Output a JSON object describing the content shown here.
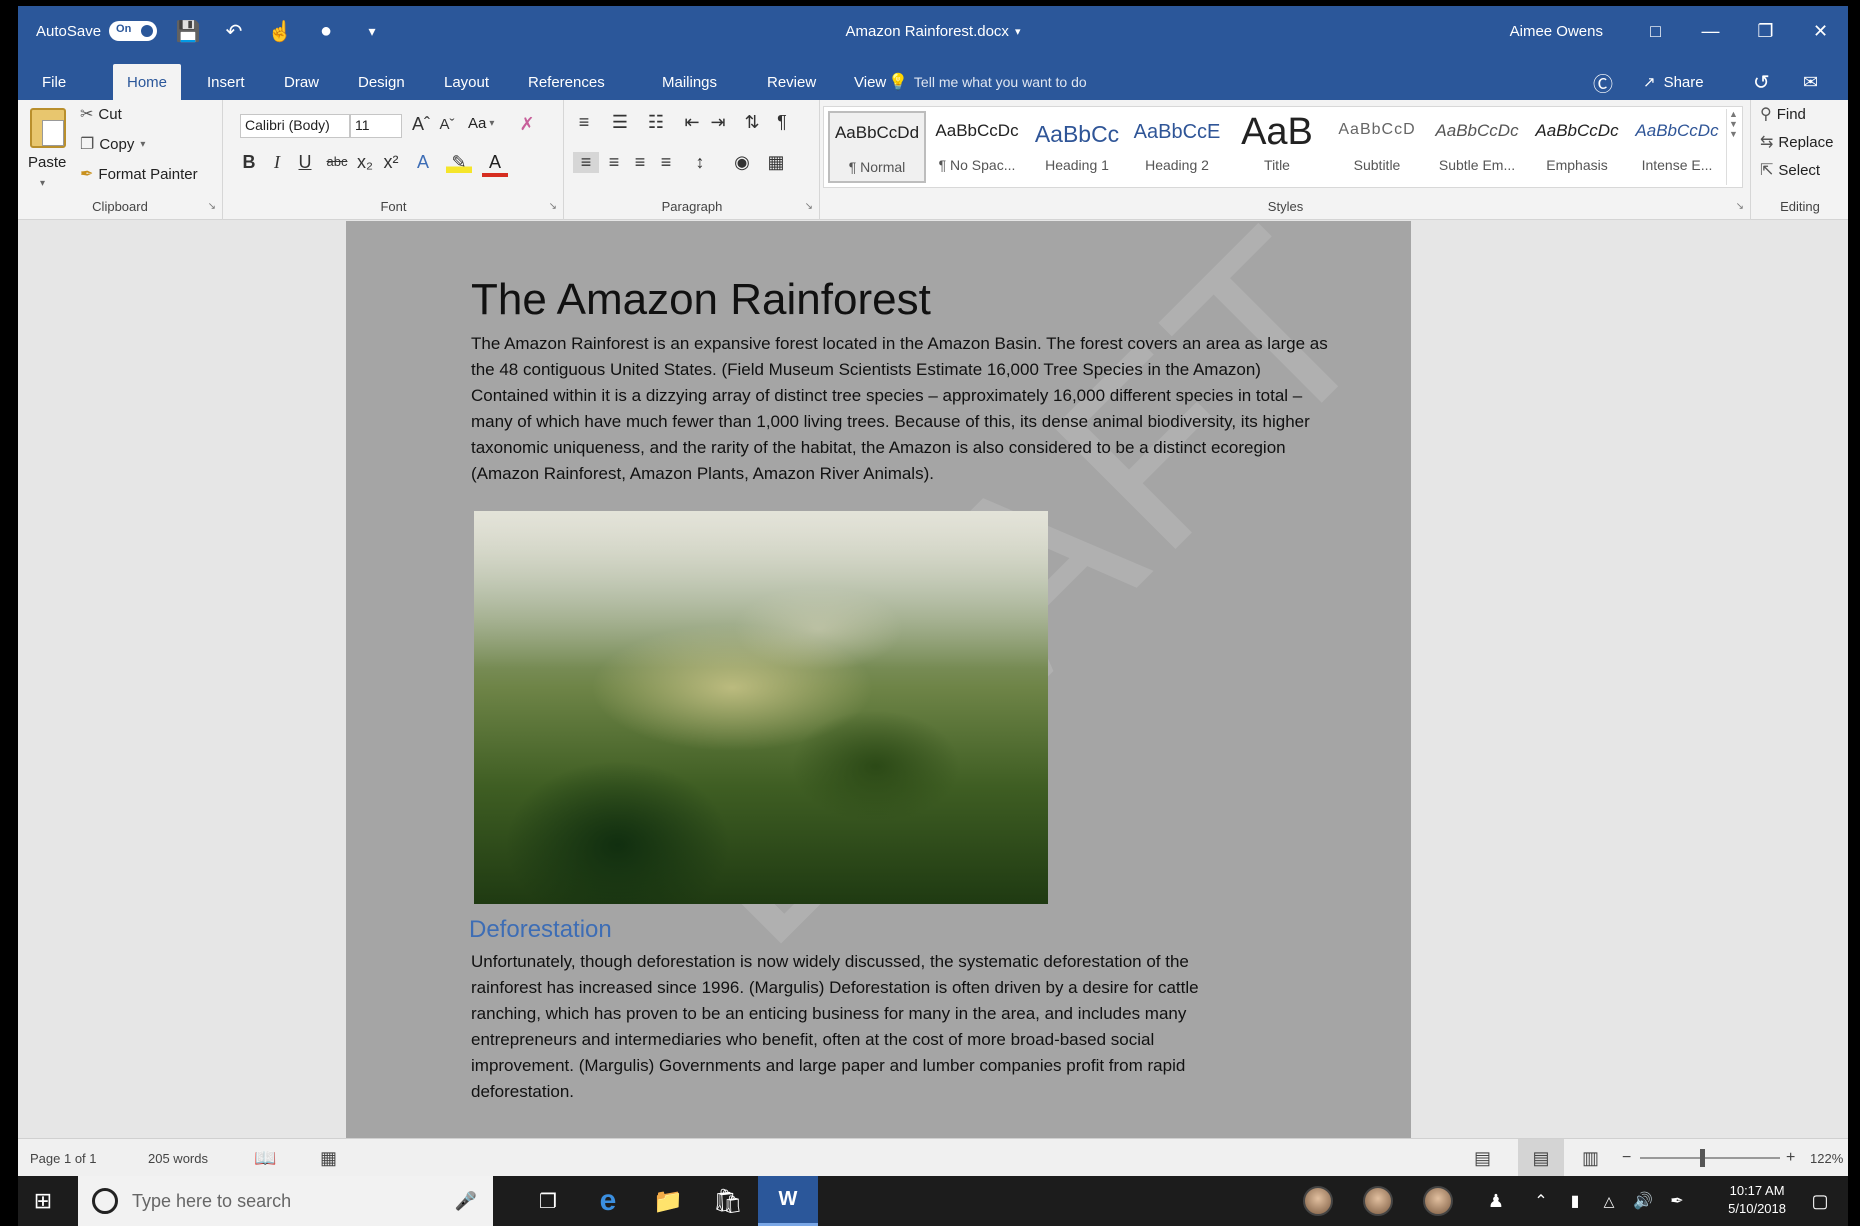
{
  "titlebar": {
    "autosave_label": "AutoSave",
    "autosave_state": "On",
    "doc_title": "Amazon Rainforest.docx",
    "user": "Aimee Owens"
  },
  "tabs": [
    "File",
    "Home",
    "Insert",
    "Draw",
    "Design",
    "Layout",
    "References",
    "Mailings",
    "Review",
    "View"
  ],
  "active_tab": "Home",
  "tellme": "Tell me what you want to do",
  "share_label": "Share",
  "clipboard": {
    "paste": "Paste",
    "cut": "Cut",
    "copy": "Copy",
    "format_painter": "Format Painter",
    "label": "Clipboard"
  },
  "font": {
    "name": "Calibri (Body)",
    "size": "11",
    "change_case": "Aa",
    "label": "Font"
  },
  "paragraph": {
    "label": "Paragraph"
  },
  "styles": {
    "label": "Styles",
    "items": [
      {
        "sample": "AaBbCcDd",
        "name": "¶ Normal"
      },
      {
        "sample": "AaBbCcDc",
        "name": "¶ No Spac..."
      },
      {
        "sample": "AaBbCc",
        "name": "Heading 1"
      },
      {
        "sample": "AaBbCcE",
        "name": "Heading 2"
      },
      {
        "sample": "AaB",
        "name": "Title"
      },
      {
        "sample": "AaBbCcD",
        "name": "Subtitle"
      },
      {
        "sample": "AaBbCcDc",
        "name": "Subtle Em..."
      },
      {
        "sample": "AaBbCcDc",
        "name": "Emphasis"
      },
      {
        "sample": "AaBbCcDc",
        "name": "Intense E..."
      }
    ],
    "accent": "#2b579a",
    "heading_color": "#3d6db5"
  },
  "editing": {
    "find": "Find",
    "replace": "Replace",
    "select": "Select",
    "label": "Editing"
  },
  "document": {
    "heading": "The Amazon Rainforest",
    "para1": "The Amazon Rainforest is an expansive forest located in the Amazon Basin.  The forest covers an area as large as the 48 contiguous United States. (Field Museum Scientists Estimate 16,000 Tree Species in the Amazon)  Contained within it is a dizzying array of distinct tree species – approximately 16,000 different species in total – many of which have much fewer than 1,000 living trees.  Because of this, its dense animal biodiversity, its higher taxonomic uniqueness, and the rarity of the habitat, the Amazon is also considered to be a distinct ecoregion  (Amazon Rainforest, Amazon Plants, Amazon River Animals).",
    "section_heading": "Deforestation",
    "para2": "Unfortunately, though deforestation is now widely discussed, the systematic deforestation of the rainforest has increased since 1996. (Margulis) Deforestation is often driven by a desire for cattle ranching, which has proven to be an enticing business for many in the area, and includes many entrepreneurs and intermediaries who benefit, often at the cost of more broad-based social improvement. (Margulis) Governments and large paper and lumber companies profit from rapid deforestation.",
    "watermark": "DRAFT"
  },
  "status": {
    "page": "Page 1 of 1",
    "words": "205 words",
    "zoom": "122%"
  },
  "taskbar": {
    "search_placeholder": "Type here to search",
    "time": "10:17 AM",
    "date": "5/10/2018"
  }
}
